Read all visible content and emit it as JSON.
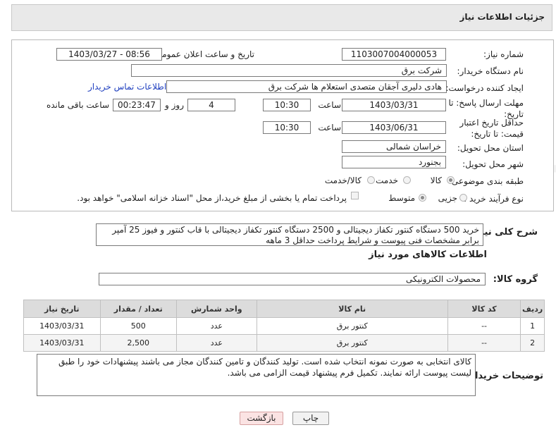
{
  "header": {
    "title": "جزئیات اطلاعات نیاز"
  },
  "form": {
    "need_number_label": "شماره نیاز:",
    "need_number": "1103007004000053",
    "announce_label": "تاریخ و ساعت اعلان عمومی:",
    "announce_value": "1403/03/27 - 08:56",
    "buyer_org_label": "نام دستگاه خریدار:",
    "buyer_org": "شرکت برق",
    "creator_label": "ایجاد کننده درخواست:",
    "creator": "هادی دلیری آجقان متصدی استعلام ها  شرکت برق",
    "contact_link": "اطلاعات تماس خریدار",
    "deadline_label": "مهلت ارسال پاسخ: تا تاریخ:",
    "deadline_date": "1403/03/31",
    "time_label": "ساعت",
    "deadline_time": "10:30",
    "days_value": "4",
    "days_label": "روز و",
    "remaining_time": "00:23:47",
    "remaining_label": "ساعت باقی مانده",
    "validity_label": "حداقل تاریخ اعتبار قیمت: تا تاریخ:",
    "validity_date": "1403/06/31",
    "validity_time": "10:30",
    "province_label": "استان محل تحویل:",
    "province": "خراسان شمالی",
    "city_label": "شهر محل تحویل:",
    "city": "بجنورد",
    "category_label": "طبقه بندی موضوعی:",
    "category_options": [
      "کالا",
      "خدمت",
      "کالا/خدمت"
    ],
    "process_label": "نوع فرآیند خرید :",
    "process_options": [
      "جزیی",
      "متوسط"
    ],
    "payment_note": "پرداخت تمام یا بخشی از مبلغ خرید،از محل \"اسناد خزانه اسلامی\" خواهد بود."
  },
  "summary": {
    "label": "شرح کلی نیاز:",
    "text": "خرید 500 دستگاه کنتور تکفاز دیجیتالی و 2500 دستگاه کنتور تکفاز دیجیتالی با قاب کنتور و فیوز 25 آمپر برابر مشخصات فنی پیوست و شرایط پرداخت حداقل 3 ماهه"
  },
  "goods": {
    "section_title": "اطلاعات کالاهای مورد نیاز",
    "group_label": "گروه کالا:",
    "group_value": "محصولات الکترونیکی",
    "columns": [
      "ردیف",
      "کد کالا",
      "نام کالا",
      "واحد شمارش",
      "تعداد / مقدار",
      "تاریخ نیاز"
    ],
    "rows": [
      {
        "row": "1",
        "code": "--",
        "name": "کنتور برق",
        "unit": "عدد",
        "qty": "500",
        "date": "1403/03/31"
      },
      {
        "row": "2",
        "code": "--",
        "name": "کنتور برق",
        "unit": "عدد",
        "qty": "2,500",
        "date": "1403/03/31"
      }
    ]
  },
  "notes": {
    "label": "توضیحات خریدار:",
    "text": "کالای انتخابی به صورت نمونه انتخاب شده است. تولید کنندگان و تامین کنندگان مجاز می باشند پیشنهادات خود را طبق لیست پیوست ارائه نمایند. تکمیل فرم پیشنهاد قیمت الزامی می باشد."
  },
  "buttons": {
    "print": "چاپ",
    "back": "بازگشت"
  },
  "watermark": "AriaTender.neT"
}
